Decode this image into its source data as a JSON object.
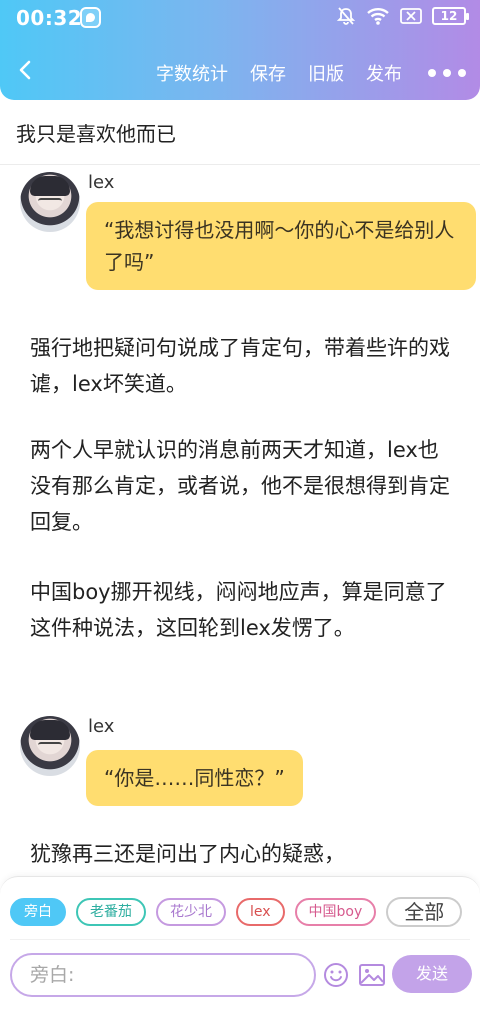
{
  "status_bar": {
    "time": "00:32",
    "battery": "12"
  },
  "header": {
    "actions": [
      "字数统计",
      "保存",
      "旧版",
      "发布"
    ]
  },
  "story": {
    "title": "我只是喜欢他而已"
  },
  "dialogs": [
    {
      "speaker": "lex",
      "text": "“我想讨得也没用啊～你的心不是给别人了吗”"
    },
    {
      "speaker": "lex",
      "text": "“你是……同性恋？”"
    }
  ],
  "paragraphs": [
    "强行地把疑问句说成了肯定句，带着些许的戏谑，lex坏笑道。",
    "两个人早就认识的消息前两天才知道，lex也没有那么肯定，或者说，他不是很想得到肯定回复。",
    "中国boy挪开视线，闷闷地应声，算是同意了这件种说法，这回轮到lex发愣了。",
    "犹豫再三还是问出了内心的疑惑，"
  ],
  "composer": {
    "chips": [
      "旁白",
      "老番茄",
      "花少北",
      "lex",
      "中国boy",
      "全部"
    ],
    "active_chip": "旁白",
    "placeholder": "旁白:",
    "send_label": "发送"
  },
  "colors": {
    "accent_blue": "#4fc8f6",
    "accent_purple": "#b28be6",
    "bubble": "#ffdd70"
  }
}
